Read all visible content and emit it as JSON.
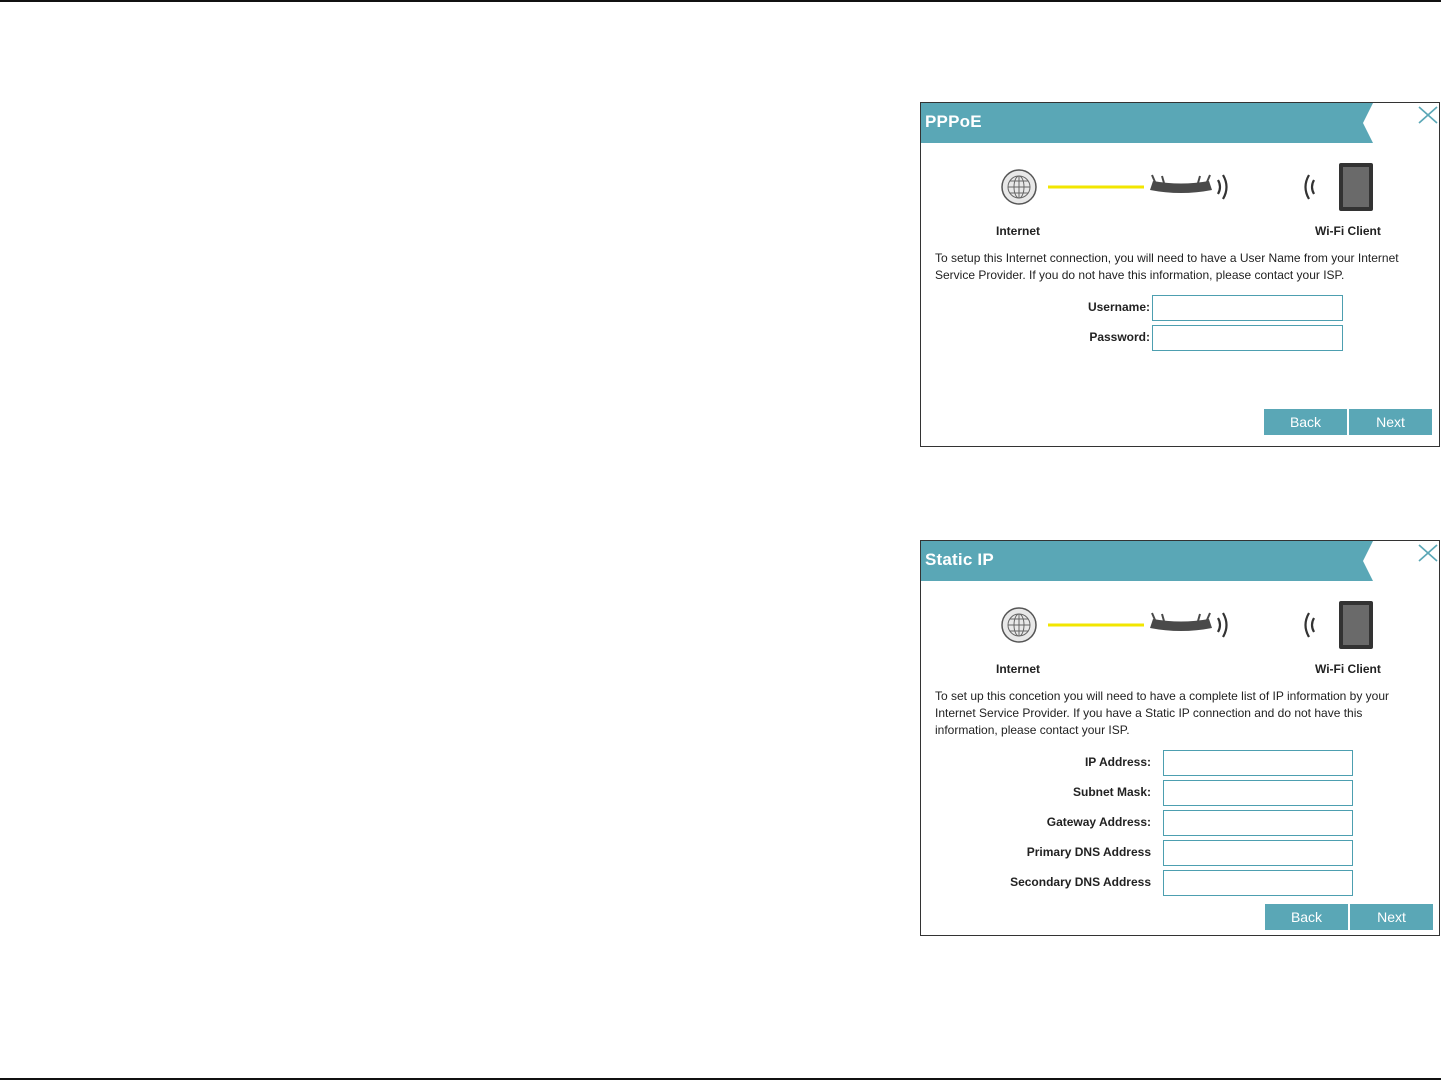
{
  "pppoe": {
    "title": "PPPoE",
    "diagram": {
      "internet_label": "Internet",
      "client_label": "Wi-Fi Client"
    },
    "description": "To setup this Internet connection, you will need to have a User Name from your Internet Service Provider. If you do not have this information, please contact your ISP.",
    "fields": [
      {
        "label": "Username:",
        "value": ""
      },
      {
        "label": "Password:",
        "value": ""
      }
    ],
    "back_label": "Back",
    "next_label": "Next"
  },
  "static_ip": {
    "title": "Static IP",
    "diagram": {
      "internet_label": "Internet",
      "client_label": "Wi-Fi Client"
    },
    "description": "To set up this concetion you will need to have a complete list of IP information by your Internet Service Provider. If you have a Static IP connection and do not have this information, please contact your ISP.",
    "fields": [
      {
        "label": "IP Address:",
        "value": ""
      },
      {
        "label": "Subnet Mask:",
        "value": ""
      },
      {
        "label": "Gateway Address:",
        "value": ""
      },
      {
        "label": "Primary DNS Address",
        "value": ""
      },
      {
        "label": "Secondary DNS Address",
        "value": ""
      }
    ],
    "back_label": "Back",
    "next_label": "Next"
  },
  "icons": [
    "close-icon",
    "globe-icon",
    "router-icon",
    "wifi-waves-icon",
    "device-icon"
  ],
  "colors": {
    "header": "#5aa7b6",
    "button": "#5aa7b6",
    "link_line": "#f2e600",
    "input_border": "#4d9fb0"
  }
}
